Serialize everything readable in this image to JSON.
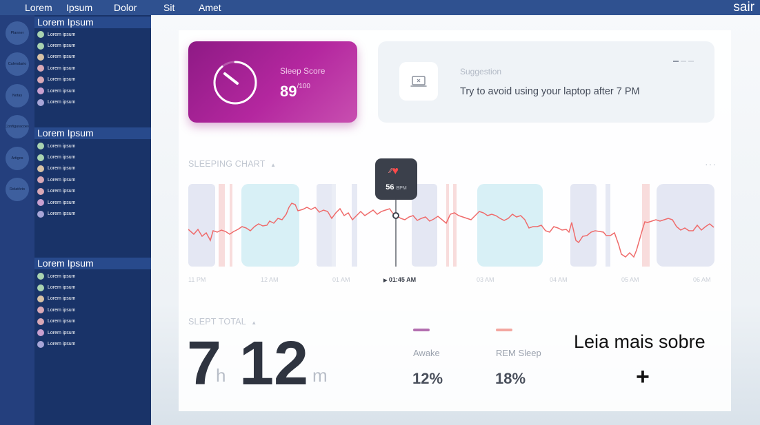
{
  "topbar": {
    "nav": [
      "Lorem",
      "Ipsum",
      "Dolor",
      "Sit",
      "Amet"
    ],
    "exit_label": "sair"
  },
  "rail": {
    "items": [
      "Planner",
      "Calendario",
      "Notas",
      "Configuracoes",
      "Artigos",
      "Relatório"
    ]
  },
  "sidebar": {
    "sections": [
      {
        "title": "Lorem Ipsum",
        "items": [
          "Lorem ipsum",
          "Lorem ipsum",
          "Lorem ipsum",
          "Lorem ipsum",
          "Lorem ipsum",
          "Lorem ipsum",
          "Lorem ipsum"
        ]
      },
      {
        "title": "Lorem Ipsum",
        "items": [
          "Lorem ipsum",
          "Lorem ipsum",
          "Lorem ipsum",
          "Lorem ipsum",
          "Lorem ipsum",
          "Lorem ipsum",
          "Lorem ipsum"
        ]
      },
      {
        "title": "Lorem Ipsum",
        "items": [
          "Lorem ipsum",
          "Lorem ipsum",
          "Lorem ipsum",
          "Lorem ipsum",
          "Lorem ipsum",
          "Lorem ipsum",
          "Lorem ipsum"
        ]
      }
    ],
    "dot_colors": [
      "#a9d3b0",
      "#a9d3b0",
      "#d9c3a6",
      "#d9a8b6",
      "#d9a8b6",
      "#c9a0d0",
      "#a8a6d8"
    ]
  },
  "sleep_score": {
    "label": "Sleep Score",
    "value": "89",
    "max": "/100",
    "fraction": 0.89
  },
  "suggestion": {
    "label": "Suggestion",
    "text": "Try to avoid using your laptop after 7 PM",
    "icon": "laptop-icon"
  },
  "sleeping_chart": {
    "title": "SLEEPING CHART",
    "bpm_value": "56",
    "bpm_unit": "BPM",
    "x_labels": [
      "11 PM",
      "12 AM",
      "01 AM",
      "01:45 AM",
      "03 AM",
      "04 AM",
      "05 AM",
      "06 AM"
    ],
    "active_label": "01:45 AM"
  },
  "slept_total": {
    "title": "SLEPT TOTAL",
    "hours": "7",
    "hours_unit": "h",
    "minutes": "12",
    "minutes_unit": "m"
  },
  "stages": [
    {
      "label": "Awake",
      "value": "12%",
      "color": "#b36fb0"
    },
    {
      "label": "REM Sleep",
      "value": "18%",
      "color": "#f3a7a0"
    }
  ],
  "read_more": {
    "label": "Leia mais sobre",
    "plus": "+"
  },
  "colors": {
    "topbar": "#2f5190",
    "rail": "#243f7d",
    "panel": "#193368",
    "accent": "#b4279f",
    "heart_line": "#ef6b6b"
  }
}
